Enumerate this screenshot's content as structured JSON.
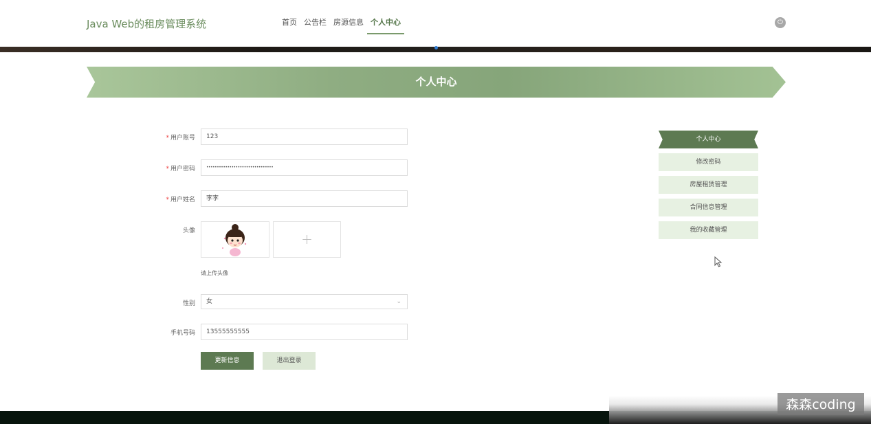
{
  "header": {
    "brand": "Java Web的租房管理系统",
    "nav": [
      {
        "label": "首页"
      },
      {
        "label": "公告栏"
      },
      {
        "label": "房源信息"
      },
      {
        "label": "个人中心"
      }
    ],
    "active_nav": "个人中心"
  },
  "page": {
    "title": "个人中心"
  },
  "form": {
    "account_label": "用户账号",
    "account_value": "123",
    "password_label": "用户密码",
    "password_value": "••••••••••••••••••••••••••••••••",
    "name_label": "用户姓名",
    "name_value": "李李",
    "avatar_label": "头像",
    "avatar_hint": "请上传头像",
    "upload_plus": "+",
    "gender_label": "性别",
    "gender_value": "女",
    "phone_label": "手机号码",
    "phone_value": "13555555555",
    "required_mark": "*",
    "update_button": "更新信息",
    "logout_button": "退出登录"
  },
  "sidebar": {
    "items": [
      {
        "label": "个人中心"
      },
      {
        "label": "修改密码"
      },
      {
        "label": "房屋租赁管理"
      },
      {
        "label": "合同信息管理"
      },
      {
        "label": "我的收藏管理"
      }
    ]
  },
  "watermark": "森森coding",
  "colors": {
    "accent": "#5d7a52",
    "accent_light": "#e7f1e2",
    "ribbon": "#8fad82",
    "brand_text": "#6a8c5d"
  }
}
